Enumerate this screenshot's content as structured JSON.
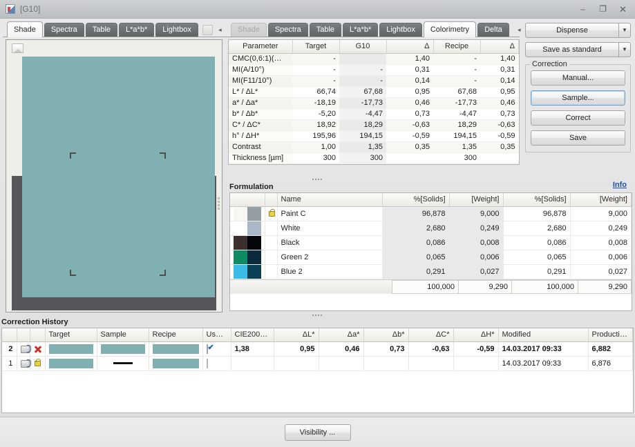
{
  "window": {
    "title": "[G10]",
    "minimize": "–",
    "maximize": "❐",
    "close": "✕"
  },
  "left_tabs": {
    "items": [
      {
        "label": "Shade",
        "active": true
      },
      {
        "label": "Spectra",
        "active": false
      },
      {
        "label": "Table",
        "active": false
      },
      {
        "label": "L*a*b*",
        "active": false
      },
      {
        "label": "Lightbox",
        "active": false
      }
    ],
    "prev_arrow": "◂",
    "next_arrow": "▸"
  },
  "shade_preview": {
    "swatch_color": "#80b0b1",
    "band_color": "#57575b",
    "background_color": "#efefe9"
  },
  "right_tabs": {
    "items": [
      {
        "label": "Shade",
        "active": false,
        "disabled": true
      },
      {
        "label": "Spectra",
        "active": false
      },
      {
        "label": "Table",
        "active": false
      },
      {
        "label": "L*a*b*",
        "active": false
      },
      {
        "label": "Lightbox",
        "active": false
      },
      {
        "label": "Colorimetry",
        "active": true
      },
      {
        "label": "Delta",
        "active": false
      }
    ],
    "prev_arrow": "◂",
    "next_arrow": "▸"
  },
  "colorimetry": {
    "columns": [
      "Parameter",
      "Target",
      "G10",
      "Δ",
      "Recipe",
      "Δ"
    ],
    "rows": [
      {
        "param": "CMC(0,6:1)(…",
        "target": "-",
        "g10": "",
        "d1": "1,40",
        "recipe": "-",
        "d2": "1,40"
      },
      {
        "param": "MI(A/10°)",
        "target": "-",
        "g10": "-",
        "d1": "0,31",
        "recipe": "-",
        "d2": "0,31"
      },
      {
        "param": "MI(F11/10°)",
        "target": "-",
        "g10": "-",
        "d1": "0,14",
        "recipe": "-",
        "d2": "0,14"
      },
      {
        "param": "L* / ΔL*",
        "target": "66,74",
        "g10": "67,68",
        "d1": "0,95",
        "recipe": "67,68",
        "d2": "0,95"
      },
      {
        "param": "a* / Δa*",
        "target": "-18,19",
        "g10": "-17,73",
        "d1": "0,46",
        "recipe": "-17,73",
        "d2": "0,46"
      },
      {
        "param": "b* / Δb*",
        "target": "-5,20",
        "g10": "-4,47",
        "d1": "0,73",
        "recipe": "-4,47",
        "d2": "0,73"
      },
      {
        "param": "C* / ΔC*",
        "target": "18,92",
        "g10": "18,29",
        "d1": "-0,63",
        "recipe": "18,29",
        "d2": "-0,63"
      },
      {
        "param": "h° / ΔH*",
        "target": "195,96",
        "g10": "194,15",
        "d1": "-0,59",
        "recipe": "194,15",
        "d2": "-0,59"
      },
      {
        "param": "Contrast",
        "target": "1,00",
        "g10": "1,35",
        "d1": "0,35",
        "recipe": "1,35",
        "d2": "0,35"
      },
      {
        "param": "Thickness [µm]",
        "target": "300",
        "g10": "300",
        "d1": "",
        "recipe": "300",
        "d2": ""
      }
    ]
  },
  "actions": {
    "dispense": "Dispense",
    "save_as_standard": "Save as standard",
    "dropdown_arrow": "▼",
    "correction_group": "Correction",
    "manual": "Manual...",
    "sample": "Sample...",
    "correct": "Correct",
    "save": "Save"
  },
  "info_link": "Info",
  "formulation": {
    "title": "Formulation",
    "columns": [
      "",
      "",
      "Name",
      "%[Solids]",
      "[Weight]",
      "%[Solids]",
      "[Weight]"
    ],
    "rows": [
      {
        "name": "Paint C",
        "sw1": "#f7f7f4",
        "sw2": "#969da4",
        "locked": true,
        "solids1": "96,878",
        "weight1": "9,000",
        "solids2": "96,878",
        "weight2": "9,000"
      },
      {
        "name": "White",
        "sw1": "#ffffff",
        "sw2": "#a8b8c6",
        "locked": false,
        "solids1": "2,680",
        "weight1": "0,249",
        "solids2": "2,680",
        "weight2": "0,249"
      },
      {
        "name": "Black",
        "sw1": "#3c302f",
        "sw2": "#04060c",
        "locked": false,
        "solids1": "0,086",
        "weight1": "0,008",
        "solids2": "0,086",
        "weight2": "0,008"
      },
      {
        "name": "Green 2",
        "sw1": "#0d8b63",
        "sw2": "#0c2a3e",
        "locked": false,
        "solids1": "0,065",
        "weight1": "0,006",
        "solids2": "0,065",
        "weight2": "0,006"
      },
      {
        "name": "Blue 2",
        "sw1": "#3bbce6",
        "sw2": "#0a3f55",
        "locked": false,
        "solids1": "0,291",
        "weight1": "0,027",
        "solids2": "0,291",
        "weight2": "0,027"
      }
    ],
    "totals": [
      "100,000",
      "9,290",
      "100,000",
      "9,290"
    ]
  },
  "history": {
    "title": "Correction History",
    "columns": [
      "",
      "",
      "",
      "Target",
      "Sample",
      "Recipe",
      "Us…",
      "CIE200…",
      "ΔL*",
      "Δa*",
      "Δb*",
      "ΔC*",
      "ΔH*",
      "Modified",
      "Producti…"
    ],
    "rows": [
      {
        "idx": "2",
        "icon2": "delete-icon",
        "target": "#80b0b1",
        "sample": "#80b0b1",
        "recipe": "#80b0b1",
        "use": true,
        "cie2000": "1,38",
        "dL": "0,95",
        "da": "0,46",
        "db": "0,73",
        "dC": "-0,63",
        "dH": "-0,59",
        "modified": "14.03.2017 09:33",
        "production": "6,882",
        "bold": true
      },
      {
        "idx": "1",
        "icon2": "lock-icon",
        "target": "#80b0b1",
        "sample": "",
        "recipe": "#80b0b1",
        "use": false,
        "cie2000": "",
        "dL": "",
        "da": "",
        "db": "",
        "dC": "",
        "dH": "",
        "modified": "14.03.2017 09:33",
        "production": "6,876",
        "bold": false
      }
    ]
  },
  "bottom": {
    "visibility": "Visibility ..."
  }
}
